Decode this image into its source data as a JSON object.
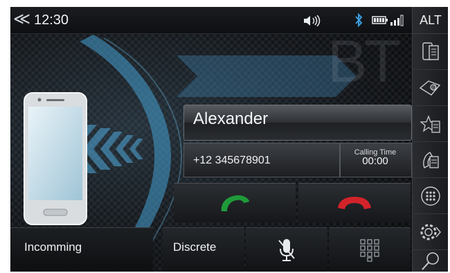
{
  "statusbar": {
    "back_icon": "back-chevron-icon",
    "time": "12:30",
    "icons": [
      "volume-icon",
      "bluetooth-icon",
      "battery-icon",
      "signal-icon"
    ]
  },
  "watermark": "BT",
  "sidebar": {
    "alt_label": "ALT",
    "buttons": [
      "phone-contacts-icon",
      "email-book-icon",
      "favorites-list-icon",
      "call-log-icon",
      "keypad-icon",
      "settings-icon",
      "search-icon"
    ]
  },
  "call": {
    "caller_name": "Alexander",
    "caller_number": "+12 345678901",
    "calling_time_label": "Calling Time",
    "calling_time_value": "00:00"
  },
  "controls": {
    "incoming_label": "Incomming",
    "discrete_label": "Discrete",
    "answer_icon": "answer-call-icon",
    "hangup_icon": "hang-up-icon",
    "mute_icon": "microphone-mute-icon",
    "keypad_icon": "keypad-icon"
  },
  "colors": {
    "accent_blue": "#4aa8d8",
    "answer_green": "#1f9a3a",
    "hangup_red": "#d2232a"
  }
}
